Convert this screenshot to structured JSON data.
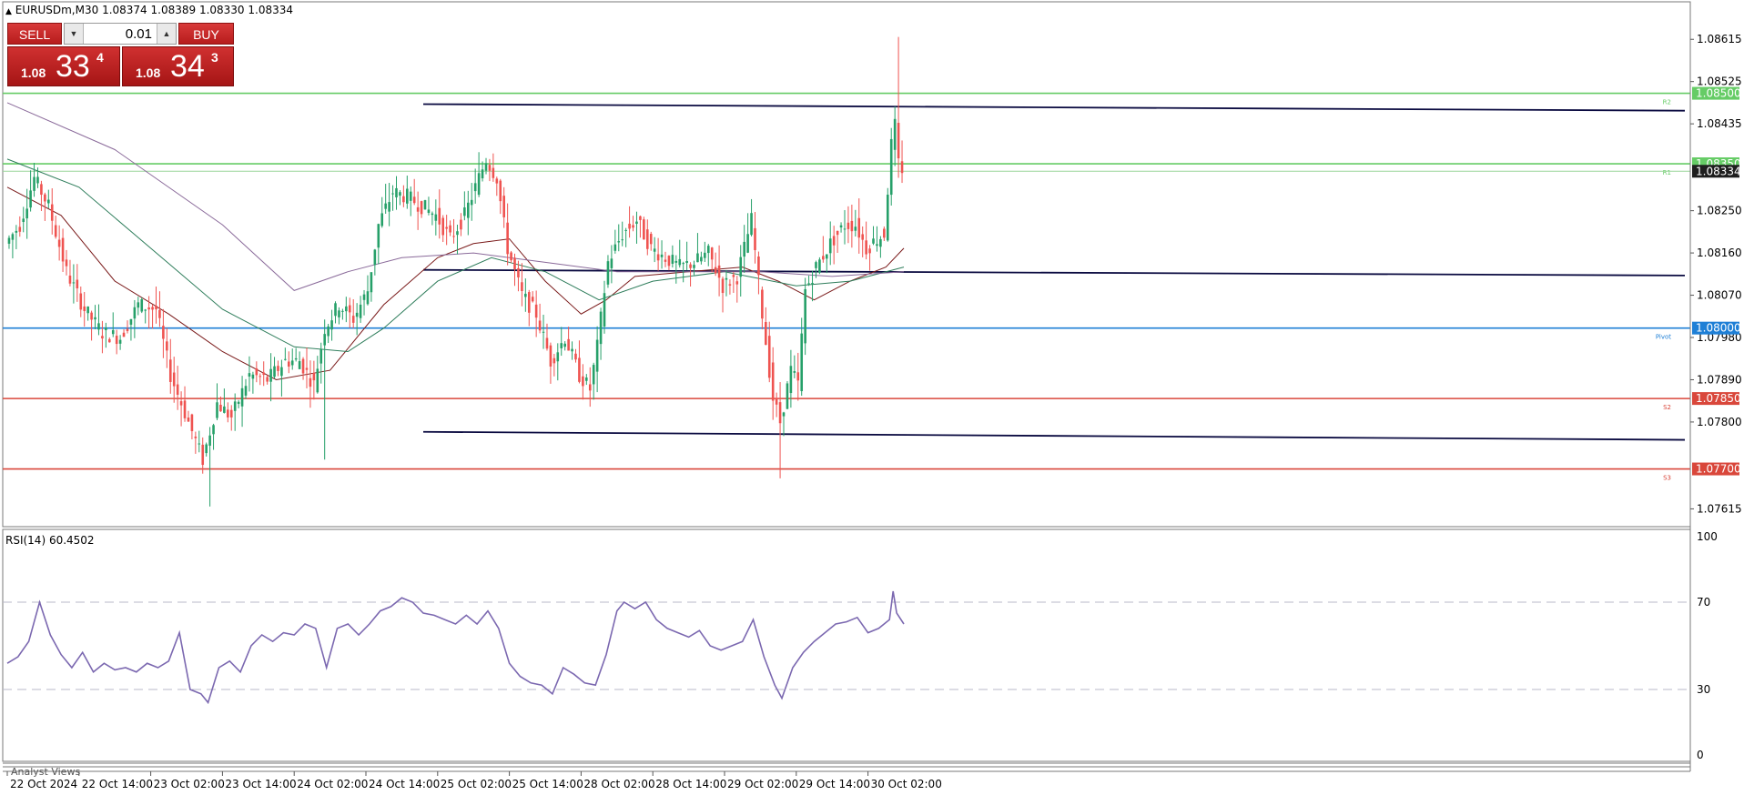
{
  "header": {
    "symbol": "EURUSDm,M30",
    "ohlc": "1.08374 1.08389 1.08330 1.08334"
  },
  "trade_panel": {
    "sell_label": "SELL",
    "buy_label": "BUY",
    "lot": "0.01",
    "sell_prefix": "1.08",
    "sell_big": "33",
    "sell_sup": "4",
    "buy_prefix": "1.08",
    "buy_big": "34",
    "buy_sup": "3"
  },
  "rsi_label": "RSI(14) 60.4502",
  "analyst_label": "Analyst Views",
  "colors": {
    "bull": "#26a069",
    "bear": "#ef5350",
    "resistance": "#66cc66",
    "pivot": "#1e7fd6",
    "support": "#d9473b",
    "channel": "#0a0a40",
    "rsi": "#7b68b0"
  },
  "chart_data": [
    {
      "type": "candlestick",
      "symbol": "EURUSDm",
      "timeframe": "M30",
      "y_ticks": [
        "1.08615",
        "1.08525",
        "1.08435",
        "1.08250",
        "1.08160",
        "1.08070",
        "1.07980",
        "1.07890",
        "1.07800",
        "1.07615"
      ],
      "ylim": [
        1.0761,
        1.0866
      ],
      "x_ticks": [
        "22 Oct 2024",
        "22 Oct 14:00",
        "23 Oct 02:00",
        "23 Oct 14:00",
        "24 Oct 02:00",
        "24 Oct 14:00",
        "25 Oct 02:00",
        "25 Oct 14:00",
        "28 Oct 02:00",
        "28 Oct 14:00",
        "29 Oct 02:00",
        "29 Oct 14:00",
        "30 Oct 02:00"
      ],
      "current_price": {
        "value": 1.08334,
        "label": "1.08334"
      },
      "levels": [
        {
          "name": "R2",
          "value": 1.085,
          "label": "1.08500",
          "kind": "resistance"
        },
        {
          "name": "R1",
          "value": 1.0835,
          "label": "1.08350",
          "kind": "resistance"
        },
        {
          "name": "Pivot",
          "value": 1.08,
          "label": "1.08000",
          "kind": "pivot"
        },
        {
          "name": "S2",
          "value": 1.0785,
          "label": "1.07850",
          "kind": "support"
        },
        {
          "name": "S3",
          "value": 1.077,
          "label": "1.07700",
          "kind": "support"
        }
      ],
      "level_tags": [
        "R2",
        "R1",
        "Pivot",
        "S2",
        "S3"
      ],
      "channel_lines": [
        {
          "name": "upper",
          "start": 1.08477,
          "end": 1.08463
        },
        {
          "name": "middle",
          "start": 1.08124,
          "end": 1.08112
        },
        {
          "name": "lower",
          "start": 1.07779,
          "end": 1.07762
        }
      ],
      "price_path": [
        [
          0,
          1.0818
        ],
        [
          4,
          1.0822
        ],
        [
          8,
          1.0832
        ],
        [
          12,
          1.0826
        ],
        [
          17,
          1.0812
        ],
        [
          22,
          1.0804
        ],
        [
          27,
          1.0799
        ],
        [
          32,
          1.0798
        ],
        [
          37,
          1.0805
        ],
        [
          42,
          1.0804
        ],
        [
          46,
          1.079
        ],
        [
          51,
          1.078
        ],
        [
          55,
          1.0772
        ],
        [
          59,
          1.0784
        ],
        [
          63,
          1.0781
        ],
        [
          68,
          1.079
        ],
        [
          73,
          1.0789
        ],
        [
          78,
          1.0793
        ],
        [
          82,
          1.0793
        ],
        [
          86,
          1.0788
        ],
        [
          89,
          1.08
        ],
        [
          93,
          1.0805
        ],
        [
          97,
          1.0802
        ],
        [
          101,
          1.0808
        ],
        [
          104,
          1.0822
        ],
        [
          108,
          1.0829
        ],
        [
          112,
          1.0828
        ],
        [
          116,
          1.0826
        ],
        [
          120,
          1.0824
        ],
        [
          124,
          1.0819
        ],
        [
          128,
          1.0824
        ],
        [
          132,
          1.0832
        ],
        [
          134,
          1.0836
        ],
        [
          137,
          1.0832
        ],
        [
          140,
          1.0817
        ],
        [
          144,
          1.0807
        ],
        [
          148,
          1.0803
        ],
        [
          152,
          1.0793
        ],
        [
          156,
          1.0798
        ],
        [
          160,
          1.079
        ],
        [
          163,
          1.0787
        ],
        [
          165,
          1.0796
        ],
        [
          168,
          1.0814
        ],
        [
          172,
          1.082
        ],
        [
          176,
          1.0823
        ],
        [
          180,
          1.0817
        ],
        [
          184,
          1.0815
        ],
        [
          188,
          1.0813
        ],
        [
          192,
          1.0814
        ],
        [
          196,
          1.0816
        ],
        [
          200,
          1.0809
        ],
        [
          204,
          1.0811
        ],
        [
          208,
          1.0823
        ],
        [
          211,
          1.0803
        ],
        [
          214,
          1.0785
        ],
        [
          216,
          1.078
        ],
        [
          219,
          1.0791
        ],
        [
          221,
          1.0788
        ],
        [
          223,
          1.0808
        ],
        [
          226,
          1.0813
        ],
        [
          230,
          1.0818
        ],
        [
          234,
          1.0822
        ],
        [
          237,
          1.0822
        ],
        [
          240,
          1.0817
        ],
        [
          243,
          1.0819
        ],
        [
          245,
          1.082
        ],
        [
          247,
          1.0839
        ],
        [
          248,
          1.0843
        ],
        [
          249,
          1.0835
        ],
        [
          250,
          1.0834
        ]
      ],
      "wicks": [
        {
          "bar": 248,
          "low": 1.0832,
          "high": 1.0862
        },
        {
          "bar": 215,
          "low": 1.0768,
          "high": 1.0785
        },
        {
          "bar": 56,
          "low": 1.0762,
          "high": 1.0775
        },
        {
          "bar": 88,
          "low": 1.0772,
          "high": 1.0786
        }
      ],
      "moving_averages": [
        {
          "period": "fast",
          "color": "#7a1a1a",
          "path": [
            [
              0,
              1.083
            ],
            [
              15,
              1.0824
            ],
            [
              30,
              1.081
            ],
            [
              45,
              1.0803
            ],
            [
              60,
              1.0795
            ],
            [
              75,
              1.0789
            ],
            [
              90,
              1.0791
            ],
            [
              105,
              1.0805
            ],
            [
              120,
              1.0815
            ],
            [
              130,
              1.0818
            ],
            [
              140,
              1.0819
            ],
            [
              150,
              1.081
            ],
            [
              160,
              1.0803
            ],
            [
              167,
              1.0806
            ],
            [
              175,
              1.0811
            ],
            [
              190,
              1.0812
            ],
            [
              205,
              1.0813
            ],
            [
              215,
              1.081
            ],
            [
              225,
              1.0806
            ],
            [
              235,
              1.081
            ],
            [
              245,
              1.0813
            ],
            [
              250,
              1.0817
            ]
          ]
        },
        {
          "period": "medium",
          "color": "#2e7d5b",
          "path": [
            [
              0,
              1.0836
            ],
            [
              20,
              1.083
            ],
            [
              40,
              1.0817
            ],
            [
              60,
              1.0804
            ],
            [
              80,
              1.0796
            ],
            [
              95,
              1.0795
            ],
            [
              105,
              1.08
            ],
            [
              120,
              1.081
            ],
            [
              135,
              1.0815
            ],
            [
              150,
              1.0812
            ],
            [
              165,
              1.0806
            ],
            [
              180,
              1.081
            ],
            [
              200,
              1.0812
            ],
            [
              220,
              1.0809
            ],
            [
              235,
              1.081
            ],
            [
              250,
              1.0813
            ]
          ]
        },
        {
          "period": "slow",
          "color": "#8a6a9a",
          "path": [
            [
              0,
              1.0848
            ],
            [
              30,
              1.0838
            ],
            [
              60,
              1.0822
            ],
            [
              80,
              1.0808
            ],
            [
              95,
              1.0812
            ],
            [
              110,
              1.0815
            ],
            [
              130,
              1.0816
            ],
            [
              150,
              1.0814
            ],
            [
              170,
              1.0812
            ],
            [
              190,
              1.0812
            ],
            [
              210,
              1.0812
            ],
            [
              230,
              1.0811
            ],
            [
              250,
              1.0812
            ]
          ]
        }
      ]
    },
    {
      "type": "line",
      "title": "RSI(14) 60.4502",
      "ylim": [
        0,
        100
      ],
      "y_ticks": [
        "100",
        "70",
        "30",
        "0"
      ],
      "guide_levels": [
        70,
        30
      ],
      "series": [
        {
          "values": [
            [
              0,
              42
            ],
            [
              3,
              45
            ],
            [
              6,
              52
            ],
            [
              9,
              70
            ],
            [
              12,
              55
            ],
            [
              15,
              46
            ],
            [
              18,
              40
            ],
            [
              21,
              47
            ],
            [
              24,
              38
            ],
            [
              27,
              42
            ],
            [
              30,
              39
            ],
            [
              33,
              40
            ],
            [
              36,
              38
            ],
            [
              39,
              42
            ],
            [
              42,
              40
            ],
            [
              45,
              43
            ],
            [
              48,
              56
            ],
            [
              51,
              30
            ],
            [
              54,
              28
            ],
            [
              56,
              24
            ],
            [
              59,
              40
            ],
            [
              62,
              43
            ],
            [
              65,
              38
            ],
            [
              68,
              50
            ],
            [
              71,
              55
            ],
            [
              74,
              52
            ],
            [
              77,
              56
            ],
            [
              80,
              55
            ],
            [
              83,
              60
            ],
            [
              86,
              58
            ],
            [
              89,
              40
            ],
            [
              92,
              58
            ],
            [
              95,
              60
            ],
            [
              98,
              55
            ],
            [
              101,
              60
            ],
            [
              104,
              66
            ],
            [
              107,
              68
            ],
            [
              110,
              72
            ],
            [
              113,
              70
            ],
            [
              116,
              65
            ],
            [
              119,
              64
            ],
            [
              122,
              62
            ],
            [
              125,
              60
            ],
            [
              128,
              64
            ],
            [
              131,
              60
            ],
            [
              134,
              66
            ],
            [
              137,
              58
            ],
            [
              140,
              42
            ],
            [
              143,
              36
            ],
            [
              146,
              33
            ],
            [
              149,
              32
            ],
            [
              152,
              28
            ],
            [
              155,
              40
            ],
            [
              158,
              37
            ],
            [
              161,
              33
            ],
            [
              164,
              32
            ],
            [
              167,
              46
            ],
            [
              170,
              66
            ],
            [
              172,
              70
            ],
            [
              175,
              67
            ],
            [
              178,
              70
            ],
            [
              181,
              62
            ],
            [
              184,
              58
            ],
            [
              187,
              56
            ],
            [
              190,
              54
            ],
            [
              193,
              57
            ],
            [
              196,
              50
            ],
            [
              199,
              48
            ],
            [
              202,
              50
            ],
            [
              205,
              52
            ],
            [
              208,
              62
            ],
            [
              211,
              45
            ],
            [
              214,
              32
            ],
            [
              216,
              26
            ],
            [
              219,
              40
            ],
            [
              222,
              47
            ],
            [
              225,
              52
            ],
            [
              228,
              56
            ],
            [
              231,
              60
            ],
            [
              234,
              61
            ],
            [
              237,
              63
            ],
            [
              240,
              56
            ],
            [
              243,
              58
            ],
            [
              246,
              62
            ],
            [
              247,
              75
            ],
            [
              248,
              65
            ],
            [
              250,
              60
            ]
          ]
        }
      ]
    }
  ]
}
